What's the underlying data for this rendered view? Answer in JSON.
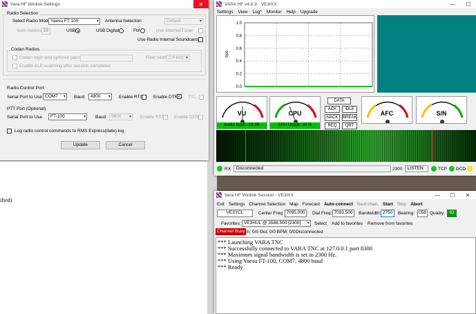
{
  "desktop": {
    "bg_text": "ified)"
  },
  "settings": {
    "title": "Vara HF Winlink Settings",
    "radio_selection": "Radio Selection",
    "select_radio_model": "Select Radio Model",
    "radio_model": "Yaesu FT-100",
    "antenna_selection": "Antenna Selection",
    "antenna_value": "Default",
    "icom_address": "Icom Address",
    "icom_value": "58",
    "usb": "USB",
    "usb_digital": "USB Digital",
    "fm": "FM",
    "use_internal_tuner": "Use Internal Tuner",
    "use_radio_internal_soundcard": "Use Radio Internal Soundcard",
    "codan_radios": "Codan Radios",
    "codan_login": "Codan login and optional password:",
    "filter_width": "Filter width:",
    "filter_value": "2.4 kHz",
    "enable_ale": "Enable ALE scanning after session completes",
    "radio_control_port": "Radio Control Port",
    "serial_port_to_use": "Serial Port to Use",
    "serial_port": "COM7",
    "baud": "Baud",
    "baud_value": "4800",
    "enable_rts": "Enable RTS",
    "enable_dtr": "Enable DTR",
    "ttl": "TTL",
    "ptt_port": "PTT Port (Optional)",
    "ptt_serial_port": "FT-100",
    "ptt_baud": "Baud",
    "ptt_baud_value": "9600",
    "ptt_enable_rts": "Enable RTS",
    "ptt_enable_dtr": "Enable DTR",
    "log_radio": "Log radio control commands to RMS Express(date).log",
    "update": "Update",
    "cancel": "Cancel"
  },
  "vara": {
    "title": "VARA HF v4.8.9",
    "callsign": "VE3IXX",
    "menu": [
      "Settings",
      "View",
      "Log*",
      "Monitor",
      "Help",
      "Upgrade"
    ],
    "y_axis_label": "bps",
    "y_ticks": [
      "1.0",
      "0.8",
      "0.6",
      "0.4",
      "0.2",
      "0.0"
    ],
    "meters": [
      {
        "label": "VU",
        "sub": "Audio Input: -18 dB"
      },
      {
        "label": "CPU",
        "sub": "CPU Usage: 35 %"
      },
      {
        "label": "AFC",
        "sub": ""
      },
      {
        "label": "S/N",
        "sub": ""
      }
    ],
    "buttons": [
      "DATA",
      "ACK",
      "IDLE",
      "NACK",
      "BREAK",
      "REQ",
      "QRT"
    ],
    "status": {
      "rx": "RX",
      "state": "Disconnected",
      "bw": "2300",
      "listen": "LISTEN",
      "tcp": "TCP",
      "dcd": "DCD"
    }
  },
  "session": {
    "title": "Vara HF Winlink Session - VE3IXX",
    "menu": [
      "Exit",
      "Settings",
      "Channel Selection",
      "Map",
      "Forecast",
      "Auto-connect",
      "Next chan.",
      "Start",
      "Stop",
      "Abort"
    ],
    "callsign": "VE3YCL",
    "center_freq_label": "Center Freq:",
    "center_freq": "7095.000",
    "dial_freq_label": "Dial Freq:",
    "dial_freq": "7093.500",
    "bandwidth_label": "Bandwidth:",
    "bandwidth": "2750",
    "bearing_label": "Bearing:",
    "bearing": "058",
    "quality_label": "Quality:",
    "quality": "63",
    "favorites_label": "Favorites:",
    "favorites": "VE3HUL @ 3588.500 [2300]",
    "select": "Select",
    "add_favorites": "Add to favorites",
    "remove_favorites": "Remove from favorites",
    "channel_busy": "Channel Busy",
    "counters": "In: 0/0   Out: 0/0   BPM: 0/0",
    "conn_state": "Disconnected",
    "log": [
      "*** Launching VARA TNC",
      "*** Successfully connected to VARA TNC at 127.0.0.1 port 8300",
      "*** Maximum signal bandwidth is set to 2300 Hz.",
      "*** Using Yaesu FT-100, COM7, 4800 baud",
      "*** Ready"
    ]
  },
  "colors": {
    "panel": "#008080",
    "waterfall": "#0a3d0a",
    "signal": "#00d000",
    "busy": "#cc0000",
    "quality": "#1a8c1a"
  }
}
